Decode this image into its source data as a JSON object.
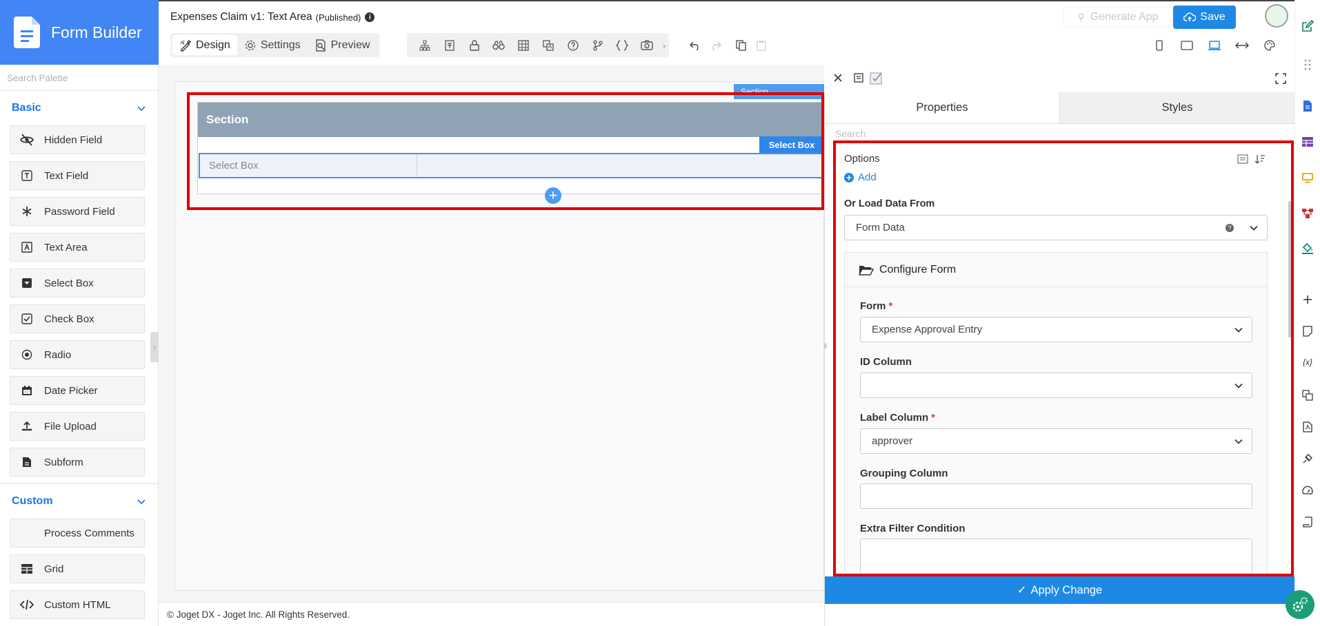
{
  "app": {
    "title": "Form Builder"
  },
  "palette": {
    "search_placeholder": "Search Palette",
    "categories": [
      {
        "label": "Basic",
        "items": [
          "Hidden Field",
          "Text Field",
          "Password Field",
          "Text Area",
          "Select Box",
          "Check Box",
          "Radio",
          "Date Picker",
          "File Upload",
          "Subform"
        ]
      },
      {
        "label": "Custom",
        "items": [
          "Process Comments",
          "Grid",
          "Custom HTML"
        ]
      }
    ]
  },
  "header": {
    "doc_title": "Expenses Claim v1: Text Area",
    "status": "(Published)",
    "tabs": [
      "Design",
      "Settings",
      "Preview"
    ],
    "generate_app": "Generate App",
    "save": "Save"
  },
  "canvas": {
    "section_title": "Section",
    "section_tag": "Section",
    "element_tag": "Select Box",
    "element_label": "Select Box"
  },
  "footer": {
    "copyright": "© Joget DX - Joget Inc. All Rights Reserved."
  },
  "panel": {
    "tabs": [
      "Properties",
      "Styles"
    ],
    "search_placeholder": "Search",
    "options_label": "Options",
    "add_label": "Add",
    "load_from_label": "Or Load Data From",
    "load_from_value": "Form Data",
    "config_title": "Configure Form",
    "fields": [
      {
        "label": "Form",
        "required": true,
        "value": "Expense Approval Entry",
        "type": "select"
      },
      {
        "label": "ID Column",
        "required": false,
        "value": "",
        "type": "select"
      },
      {
        "label": "Label Column",
        "required": true,
        "value": "approver",
        "type": "select"
      },
      {
        "label": "Grouping Column",
        "required": false,
        "value": "",
        "type": "text"
      },
      {
        "label": "Extra Filter Condition",
        "required": false,
        "value": "",
        "type": "textarea"
      }
    ],
    "apply": "Apply Change"
  },
  "colors": {
    "brand": "#4285f4",
    "primary": "#1e88e5",
    "highlight": "#e00000",
    "section_header": "#8fa3b5"
  }
}
